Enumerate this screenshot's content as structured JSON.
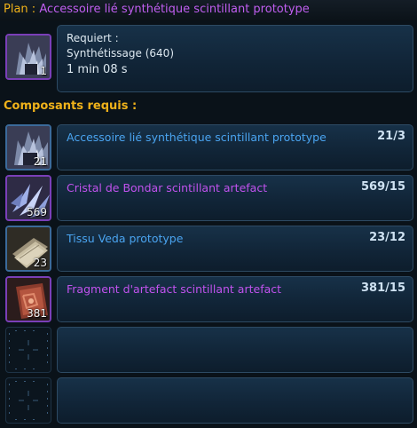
{
  "plan": {
    "label": "Plan :",
    "name": "Accessoire lié synthétique scintillant prototype",
    "icon": "crystal-cluster-icon",
    "quantity": "1"
  },
  "requirements": {
    "label": "Requiert :",
    "skill": "Synthétissage (640)",
    "time": "1 min 08 s"
  },
  "components_title": "Composants requis :",
  "components": [
    {
      "name": "Accessoire lié synthétique scintillant prototype",
      "count": "21/3",
      "quantity": "21",
      "color": "#4aa4f0",
      "icon": "crystal-cluster-icon"
    },
    {
      "name": "Cristal de Bondar scintillant artefact",
      "count": "569/15",
      "quantity": "569",
      "color": "#c152ee",
      "icon": "crystal-shards-icon"
    },
    {
      "name": "Tissu Veda prototype",
      "count": "23/12",
      "quantity": "23",
      "color": "#4aa4f0",
      "icon": "fabric-icon"
    },
    {
      "name": "Fragment d'artefact scintillant artefact",
      "count": "381/15",
      "quantity": "381",
      "color": "#c152ee",
      "icon": "artifact-fragment-icon"
    }
  ],
  "colors": {
    "header_label": "#f0b21a",
    "prototype_blue": "#4aa4f0",
    "artifact_purple": "#c152ee"
  }
}
